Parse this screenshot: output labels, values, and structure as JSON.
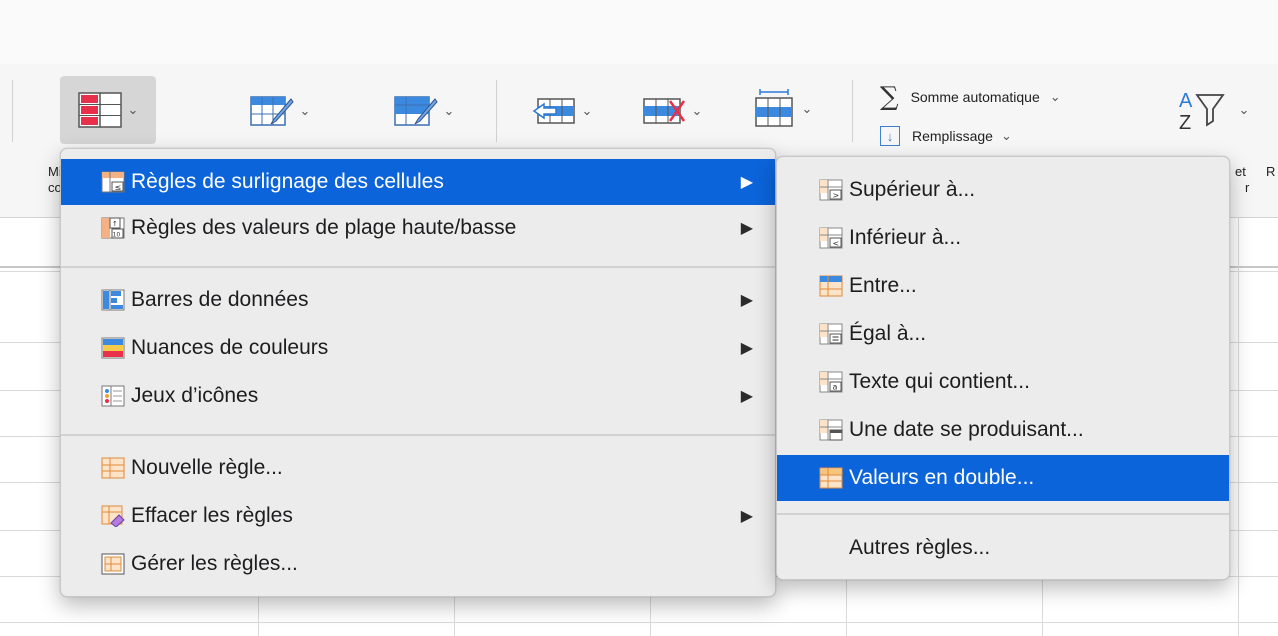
{
  "ribbon": {
    "autosum_label": "Somme automatique",
    "autosum_symbol": "∑",
    "fill_label": "Remplissage",
    "chevron": "⌄",
    "cut_left_top": "Mi",
    "cut_left_bottom": "co",
    "cut_right_top": "et",
    "cut_right_bottom": "r",
    "cut_far_right": "R"
  },
  "main_menu": {
    "items": [
      {
        "label": "Règles de surlignage des cellules",
        "icon": "highlight-rules-icon",
        "has_submenu": true,
        "active": true
      },
      {
        "label": "Règles des valeurs de plage haute/basse",
        "icon": "top-bottom-rules-icon",
        "has_submenu": true
      },
      {
        "label": "Barres de données",
        "icon": "data-bars-icon",
        "has_submenu": true
      },
      {
        "label": "Nuances de couleurs",
        "icon": "color-scales-icon",
        "has_submenu": true
      },
      {
        "label": "Jeux d’icônes",
        "icon": "icon-sets-icon",
        "has_submenu": true
      },
      {
        "label": "Nouvelle règle...",
        "icon": "new-rule-icon",
        "has_submenu": false
      },
      {
        "label": "Effacer les règles",
        "icon": "clear-rules-icon",
        "has_submenu": true
      },
      {
        "label": "Gérer les règles...",
        "icon": "manage-rules-icon",
        "has_submenu": false
      }
    ],
    "submenu_arrow": "▶"
  },
  "sub_menu": {
    "items": [
      {
        "label": "Supérieur à...",
        "icon": "greater-than-icon"
      },
      {
        "label": "Inférieur à...",
        "icon": "less-than-icon"
      },
      {
        "label": "Entre...",
        "icon": "between-icon"
      },
      {
        "label": "Égal à...",
        "icon": "equal-to-icon"
      },
      {
        "label": "Texte qui contient...",
        "icon": "text-contains-icon"
      },
      {
        "label": "Une date se produisant...",
        "icon": "date-occurring-icon"
      },
      {
        "label": "Valeurs en double...",
        "icon": "duplicate-values-icon",
        "active": true
      },
      {
        "label": "Autres règles...",
        "icon": ""
      }
    ]
  },
  "colors": {
    "accent": "#0b64d9",
    "menu_bg": "#ececec",
    "ribbon_bg": "#f6f6f6"
  }
}
